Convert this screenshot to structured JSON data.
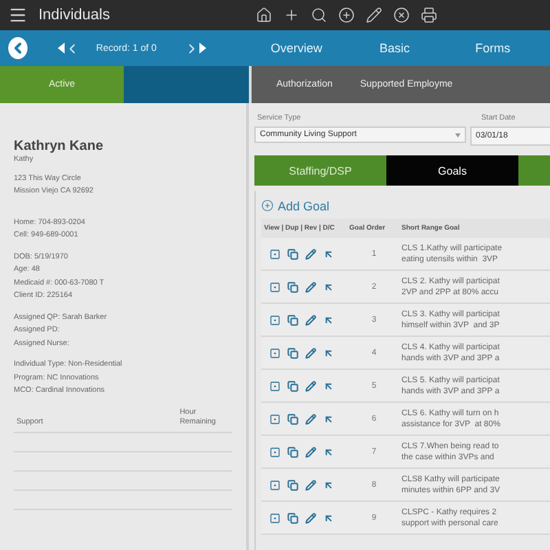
{
  "app_bar": {
    "title": "Individuals"
  },
  "nav_bar": {
    "record": "Record: 1 of 0",
    "links": [
      "Overview",
      "Basic",
      "Forms"
    ]
  },
  "section_bar": {
    "status": "Active",
    "tabs": [
      "Authorization",
      "Supported Employme"
    ]
  },
  "profile": {
    "name": "Kathryn Kane",
    "nickname": "Kathy",
    "address": [
      "123 This Way Circle",
      "Mission Viejo CA 92692"
    ],
    "phones": [
      "Home: 704-893-0204",
      "Cell: 949-689-0001"
    ],
    "ids": [
      "DOB: 5/19/1970",
      "Age: 48",
      "Medicaid #: 000-63-7080 T",
      "Client ID: 225164"
    ],
    "assigned": [
      "Assigned QP: Sarah Barker",
      "Assigned PD:",
      "Assigned Nurse:"
    ],
    "program": [
      "Individual Type: Non-Residential",
      "Program: NC Innovations",
      "MCO: Cardinal Innovations"
    ]
  },
  "support_table": {
    "columns": [
      "Support",
      "Hour\nRemaining"
    ]
  },
  "service": {
    "type_label": "Service Type",
    "type_value": "Community Living Support",
    "date_label": "Start Date",
    "date_value": "03/01/18"
  },
  "goal_tabs": [
    {
      "label": "Staffing/DSP",
      "selected": false
    },
    {
      "label": "Goals",
      "selected": true
    }
  ],
  "goals": {
    "add": "Add Goal",
    "columns": [
      "View | Dup | Rev | D/C",
      "Goal Order",
      "Short Range Goal"
    ],
    "rows": [
      {
        "order": "1",
        "goal": "CLS 1.Kathy will participate\neating utensils within  3VP"
      },
      {
        "order": "2",
        "goal": "CLS 2. Kathy will participat\n2VP and 2PP at 80% accu"
      },
      {
        "order": "3",
        "goal": "CLS 3. Kathy will participat\nhimself within 3VP  and 3P"
      },
      {
        "order": "4",
        "goal": "CLS 4. Kathy will participat\nhands with 3VP and 3PP a"
      },
      {
        "order": "5",
        "goal": "CLS 5. Kathy will participat\nhands with 3VP and 3PP a"
      },
      {
        "order": "6",
        "goal": "CLS 6. Kathy will turn on h\nassistance for 3VP  at 80%"
      },
      {
        "order": "7",
        "goal": "CLS 7.When being read to\nthe case within 3VPs and"
      },
      {
        "order": "8",
        "goal": "CLS8 Kathy will participate\nminutes within 6PP and 3V"
      },
      {
        "order": "9",
        "goal": "CLSPC - Kathy requires 2\nsupport with personal care"
      }
    ]
  }
}
